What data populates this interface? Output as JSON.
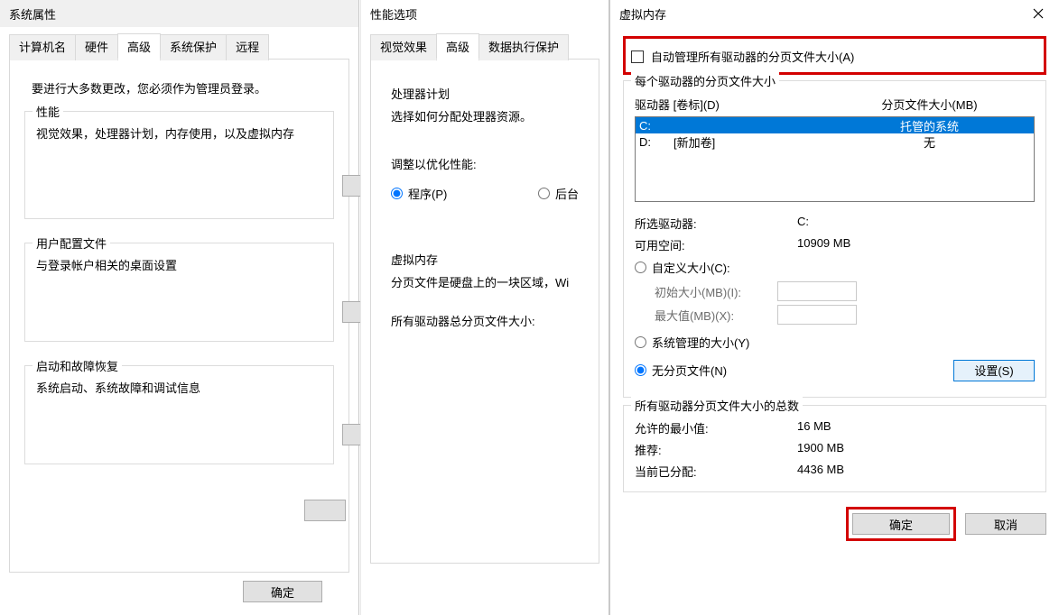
{
  "sysprops": {
    "title": "系统属性",
    "tabs": [
      "计算机名",
      "硬件",
      "高级",
      "系统保护",
      "远程"
    ],
    "active_tab": 2,
    "intro": "要进行大多数更改，您必须作为管理员登录。",
    "groups": {
      "performance": {
        "title": "性能",
        "desc": "视觉效果，处理器计划，内存使用，以及虚拟内存"
      },
      "profiles": {
        "title": "用户配置文件",
        "desc": "与登录帐户相关的桌面设置"
      },
      "startup": {
        "title": "启动和故障恢复",
        "desc": "系统启动、系统故障和调试信息"
      }
    },
    "ok": "确定"
  },
  "perf": {
    "title": "性能选项",
    "tabs": [
      "视觉效果",
      "高级",
      "数据执行保护"
    ],
    "active_tab": 1,
    "processor": {
      "title": "处理器计划",
      "desc": "选择如何分配处理器资源。",
      "adjust": "调整以优化性能:",
      "programs": "程序(P)",
      "background_partial": "后台"
    },
    "vm_section": {
      "title": "虚拟内存",
      "desc": "分页文件是硬盘上的一块区域，Wi",
      "total": "所有驱动器总分页文件大小:"
    }
  },
  "vm": {
    "title": "虚拟内存",
    "auto_manage": "自动管理所有驱动器的分页文件大小(A)",
    "drive_group_title": "每个驱动器的分页文件大小",
    "header_drive": "驱动器 [卷标](D)",
    "header_size": "分页文件大小(MB)",
    "drives": [
      {
        "label": "C:",
        "volume": "",
        "size": "托管的系统",
        "selected": true
      },
      {
        "label": "D:",
        "volume": "[新加卷]",
        "size": "无",
        "selected": false
      }
    ],
    "selected_drive_label": "所选驱动器:",
    "selected_drive_value": "C:",
    "space_label": "可用空间:",
    "space_value": "10909 MB",
    "custom_size": "自定义大小(C):",
    "initial_label": "初始大小(MB)(I):",
    "max_label": "最大值(MB)(X):",
    "system_managed": "系统管理的大小(Y)",
    "no_paging": "无分页文件(N)",
    "set_btn": "设置(S)",
    "totals_title": "所有驱动器分页文件大小的总数",
    "min_label": "允许的最小值:",
    "min_value": "16 MB",
    "rec_label": "推荐:",
    "rec_value": "1900 MB",
    "cur_label": "当前已分配:",
    "cur_value": "4436 MB",
    "ok": "确定",
    "cancel": "取消"
  }
}
